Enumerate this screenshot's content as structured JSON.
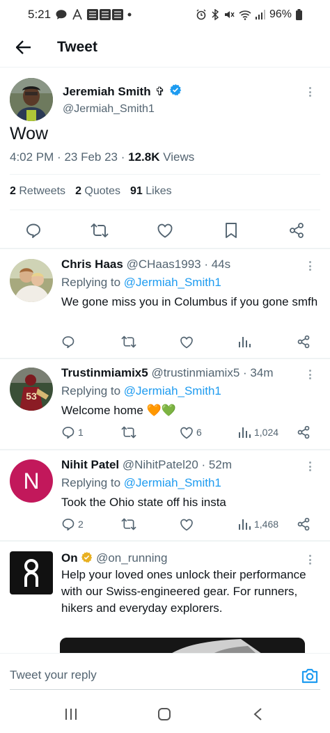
{
  "status_bar": {
    "time": "5:21",
    "battery": "96%"
  },
  "header": {
    "title": "Tweet"
  },
  "main_tweet": {
    "name": "Jeremiah Smith",
    "name_suffix": "✞",
    "handle": "@Jermiah_Smith1",
    "text": "Wow",
    "time": "4:02 PM",
    "date": "23 Feb 23",
    "views_count": "12.8K",
    "views_label": "Views",
    "retweets_count": "2",
    "retweets_label": "Retweets",
    "quotes_count": "2",
    "quotes_label": "Quotes",
    "likes_count": "91",
    "likes_label": "Likes"
  },
  "replies": [
    {
      "name": "Chris Haas",
      "handle": "@CHaas1993",
      "time": "· 44s",
      "replying_prefix": "Replying to",
      "replying_to": "@Jermiah_Smith1",
      "text": "We gone miss you in Columbus if you gone smfh",
      "reply_count": "",
      "like_count": "",
      "views": ""
    },
    {
      "name": "Trustinmiamix5",
      "handle": "@trustinmiamix5",
      "time": "· 34m",
      "replying_prefix": "Replying to",
      "replying_to": "@Jermiah_Smith1",
      "text": "Welcome home 🧡💚",
      "reply_count": "1",
      "like_count": "6",
      "views": "1,024"
    },
    {
      "name": "Nihit Patel",
      "handle": "@NihitPatel20",
      "time": "· 52m",
      "replying_prefix": "Replying to",
      "replying_to": "@Jermiah_Smith1",
      "text": "Took the Ohio state off his insta",
      "reply_count": "2",
      "like_count": "",
      "views": "1,468",
      "avatar_letter": "N"
    }
  ],
  "ad": {
    "name": "On",
    "handle": "@on_running",
    "text": "Help your loved ones unlock their performance with our Swiss-engineered gear. For runners, hikers and everyday explorers."
  },
  "reply_bar": {
    "placeholder": "Tweet your reply"
  },
  "colors": {
    "accent": "#1d9bf0",
    "verified": "#1d9bf0",
    "ad_verified": "#e8b021",
    "text_secondary": "#536471"
  }
}
